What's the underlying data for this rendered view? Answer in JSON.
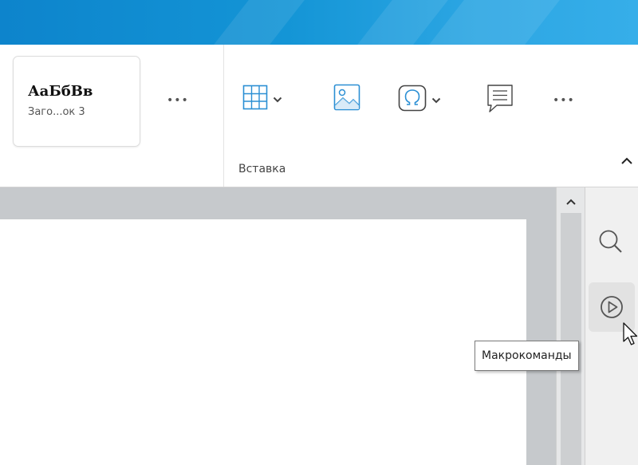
{
  "ribbon": {
    "style_gallery": {
      "sample_text": "АаБбВв",
      "style_name": "Заго...ок 3",
      "more_label": "•••"
    },
    "insert_group": {
      "label": "Вставка",
      "buttons": [
        {
          "name": "table",
          "icon": "table-icon",
          "has_dropdown": true
        },
        {
          "name": "image",
          "icon": "image-icon",
          "has_dropdown": false
        },
        {
          "name": "symbol",
          "icon": "omega-icon",
          "has_dropdown": true
        },
        {
          "name": "comment",
          "icon": "comment-icon",
          "has_dropdown": false
        }
      ],
      "more_label": "•••"
    }
  },
  "side_panel": {
    "buttons": [
      {
        "name": "search",
        "icon": "search-icon"
      },
      {
        "name": "macros",
        "icon": "play-circle-icon",
        "active": true
      }
    ]
  },
  "tooltip": {
    "text": "Макрокоманды"
  },
  "colors": {
    "accent": "#1495d6",
    "icon_blue": "#2b8fd4",
    "workspace": "#c6c9cc"
  }
}
